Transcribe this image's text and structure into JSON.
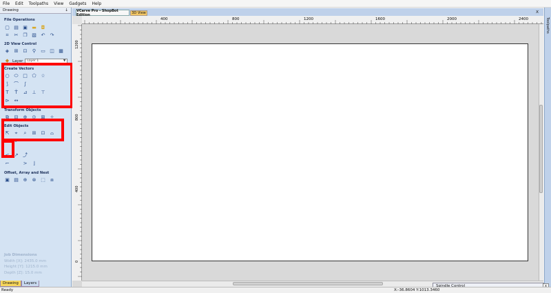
{
  "menu": [
    "File",
    "Edit",
    "Toolpaths",
    "View",
    "Gadgets",
    "Help"
  ],
  "panel": {
    "title": "Drawing",
    "pin_glyph": "↓",
    "sections": {
      "file_operations": "File Operations",
      "view_control": "2D View Control",
      "create_vectors": "Create Vectors",
      "transform_objects": "Transform Objects",
      "edit_objects": "Edit Objects",
      "offset": "Offset, Array and Nest"
    },
    "layer_label": "Layer",
    "layer_value": "Layer 1",
    "job_dimensions": {
      "title": "Job Dimensions",
      "width": "Width  [X]: 2435.0 mm",
      "height": "Height [Y]: 1215.0 mm",
      "depth": "Depth  [Z]: 15.0 mm"
    },
    "tabs": {
      "drawing": "Drawing",
      "layers": "Layers"
    }
  },
  "icons": {
    "file_ops": [
      "new-file-icon",
      "open-file-icon",
      "save-icon",
      "import-icon",
      "export-icon",
      "cut-icon",
      "copy-icon",
      "paste-icon",
      "undo-icon",
      "redo-icon"
    ],
    "view": [
      "zoom-all-icon",
      "zoom-box-icon",
      "zoom-icon",
      "view-sheet-icon",
      "view-both-icon",
      "view-3d-icon"
    ],
    "create": [
      "circle-icon",
      "ellipse-icon",
      "rectangle-icon",
      "polygon-icon",
      "star-icon",
      "polyline-icon",
      "arc-icon",
      "curve-icon",
      "text-icon",
      "text-on-curve-icon",
      "dimension-icon",
      "ruler-icon",
      "measure-icon",
      "dim-arrow-icon",
      "dim-line-icon"
    ],
    "transform": [
      "move-icon",
      "scale-icon",
      "rotate-icon",
      "mirror-icon",
      "align-icon",
      "distort-icon"
    ],
    "edit": [
      "select-icon",
      "node-edit-icon",
      "trim-icon",
      "join-icon",
      "close-vector-icon",
      "smooth-icon"
    ]
  },
  "document_tabs": {
    "main": "VCarve Pro - ShopBot Edition",
    "view3d": "3D View",
    "close": "x"
  },
  "ruler": {
    "h_labels": [
      "400",
      "800",
      "1200",
      "1600",
      "2000",
      "2400"
    ],
    "v_labels": [
      "1200",
      "800",
      "400",
      "0"
    ]
  },
  "toolpaths_tab": "Toolpaths",
  "status": {
    "left": "Ready",
    "coords": "X:-36.8604 Y:1013.3460"
  },
  "spindle": {
    "title": "Spindle Control",
    "close": "x"
  },
  "colors": {
    "highlight": "#ff0000",
    "panel_bg": "#d4e3f3",
    "accent": "#f8d75c"
  }
}
